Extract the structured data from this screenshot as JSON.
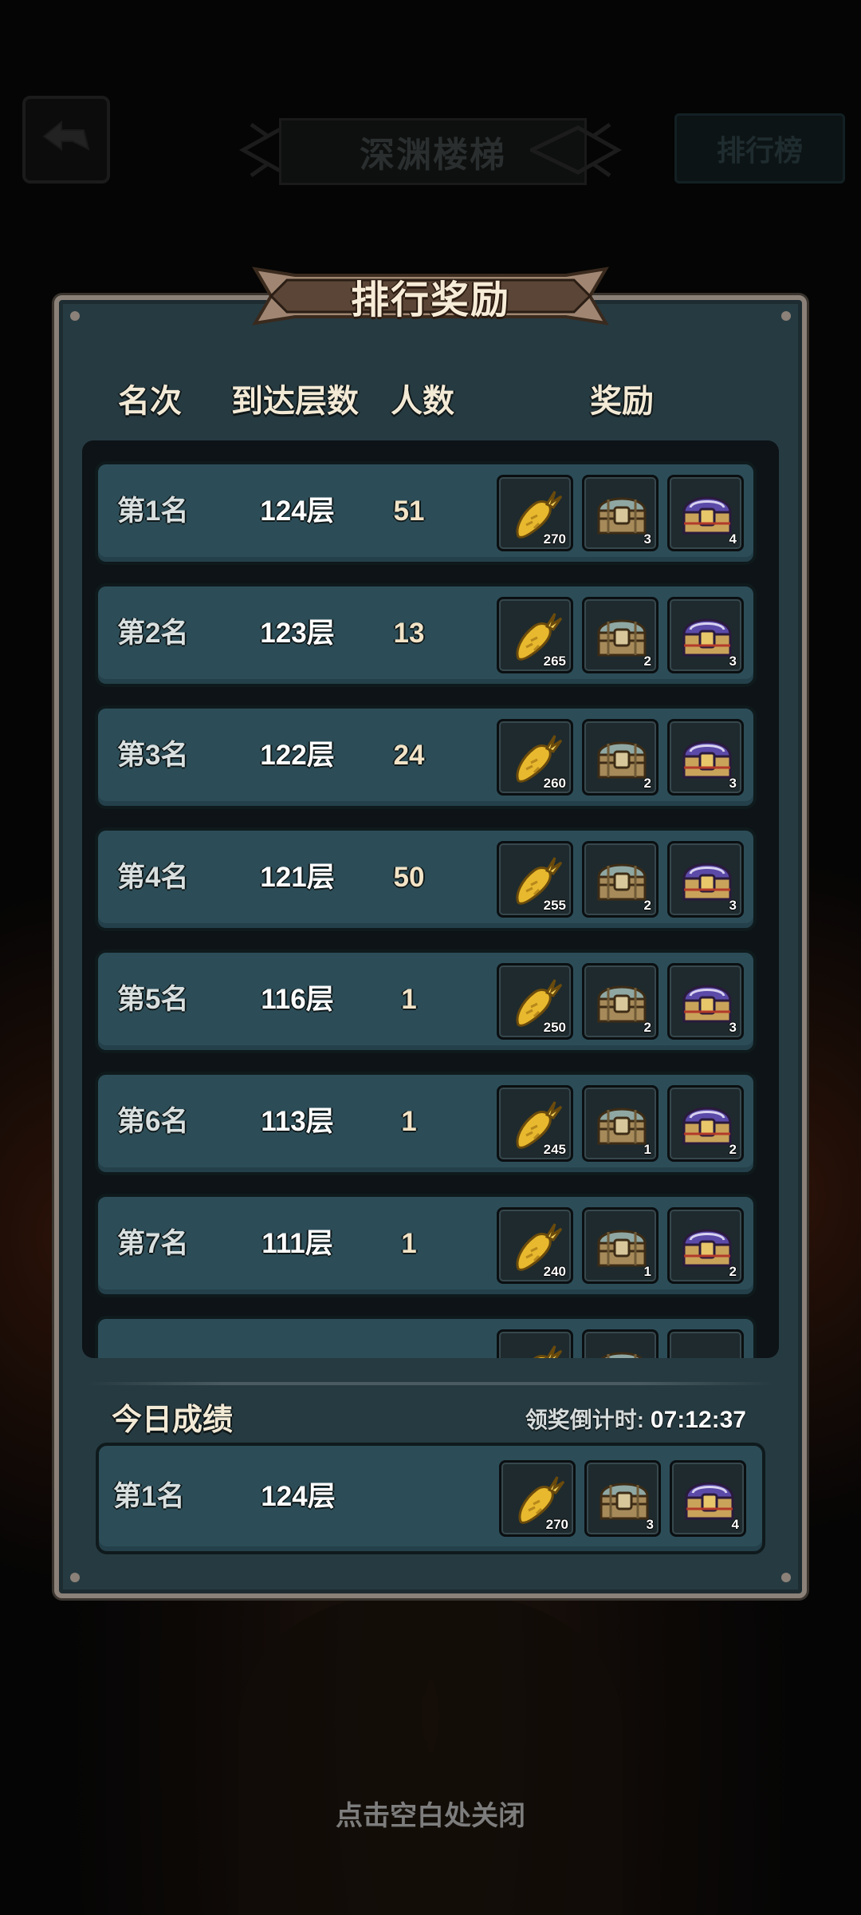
{
  "top_bar": {
    "back_icon": "back-arrow-icon",
    "title": "深渊楼梯",
    "leaderboard_label": "排行榜"
  },
  "modal": {
    "title": "排行奖励",
    "columns": {
      "rank": "名次",
      "floor": "到达层数",
      "count": "人数",
      "reward": "奖励"
    },
    "rows": [
      {
        "rank": "第1名",
        "floor": "124层",
        "count": "51",
        "rewards": [
          {
            "item": "golden-carrot",
            "qty": "270"
          },
          {
            "item": "bronze-chest",
            "qty": "3"
          },
          {
            "item": "purple-chest",
            "qty": "4"
          }
        ]
      },
      {
        "rank": "第2名",
        "floor": "123层",
        "count": "13",
        "rewards": [
          {
            "item": "golden-carrot",
            "qty": "265"
          },
          {
            "item": "bronze-chest",
            "qty": "2"
          },
          {
            "item": "purple-chest",
            "qty": "3"
          }
        ]
      },
      {
        "rank": "第3名",
        "floor": "122层",
        "count": "24",
        "rewards": [
          {
            "item": "golden-carrot",
            "qty": "260"
          },
          {
            "item": "bronze-chest",
            "qty": "2"
          },
          {
            "item": "purple-chest",
            "qty": "3"
          }
        ]
      },
      {
        "rank": "第4名",
        "floor": "121层",
        "count": "50",
        "rewards": [
          {
            "item": "golden-carrot",
            "qty": "255"
          },
          {
            "item": "bronze-chest",
            "qty": "2"
          },
          {
            "item": "purple-chest",
            "qty": "3"
          }
        ]
      },
      {
        "rank": "第5名",
        "floor": "116层",
        "count": "1",
        "rewards": [
          {
            "item": "golden-carrot",
            "qty": "250"
          },
          {
            "item": "bronze-chest",
            "qty": "2"
          },
          {
            "item": "purple-chest",
            "qty": "3"
          }
        ]
      },
      {
        "rank": "第6名",
        "floor": "113层",
        "count": "1",
        "rewards": [
          {
            "item": "golden-carrot",
            "qty": "245"
          },
          {
            "item": "bronze-chest",
            "qty": "1"
          },
          {
            "item": "purple-chest",
            "qty": "2"
          }
        ]
      },
      {
        "rank": "第7名",
        "floor": "111层",
        "count": "1",
        "rewards": [
          {
            "item": "golden-carrot",
            "qty": "240"
          },
          {
            "item": "bronze-chest",
            "qty": "1"
          },
          {
            "item": "purple-chest",
            "qty": "2"
          }
        ]
      }
    ],
    "today": {
      "label": "今日成绩",
      "countdown_label": "领奖倒计时:",
      "countdown_value": "07:12:37",
      "rank": "第1名",
      "floor": "124层",
      "rewards": [
        {
          "item": "golden-carrot",
          "qty": "270"
        },
        {
          "item": "bronze-chest",
          "qty": "3"
        },
        {
          "item": "purple-chest",
          "qty": "4"
        }
      ]
    }
  },
  "close_hint": "点击空白处关闭",
  "colors": {
    "panel": "#263a41",
    "row": "#2c4d58",
    "frame": "#8b8178",
    "banner": "#5b4536"
  }
}
